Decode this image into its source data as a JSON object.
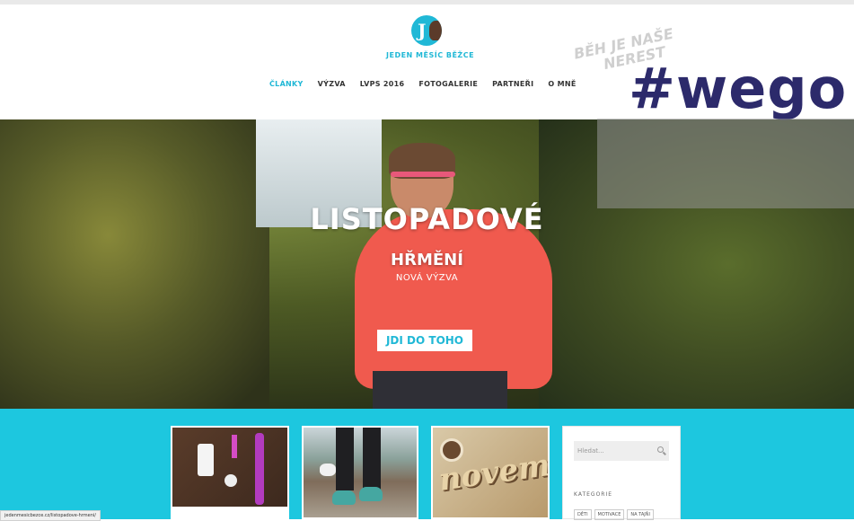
{
  "site": {
    "logo_text": "JEDEN MĚSÍC BĚŽCE",
    "logo_letter": "J"
  },
  "nav": {
    "items": [
      "ČLÁNKY",
      "VÝZVA",
      "LVPS 2016",
      "FOTOGALERIE",
      "PARTNEŘI",
      "O MNĚ"
    ],
    "active_index": 0
  },
  "watermark": {
    "line1": "BĚH JE NAŠE",
    "line2": "NEREST"
  },
  "overlay": {
    "hashtag": "#wego"
  },
  "hero": {
    "title_line1": "LISTOPADOVÉ",
    "title_line2": "HŘMĚNÍ",
    "subtitle": "NOVÁ VÝZVA",
    "cta_label": "JDI DO TOHO"
  },
  "cards": {
    "card3_word": "november"
  },
  "sidebar": {
    "search_placeholder": "Hledat...",
    "categories_title": "KATEGORIE",
    "tags": [
      "DĚTI",
      "MOTIVACE",
      "NA TAJŇI"
    ]
  },
  "status_bar": {
    "url": "jedenmesicbezce.cz/listopadove-hrmeni/"
  },
  "colors": {
    "accent": "#20b8d6",
    "teal_band": "#1dc7df",
    "cta_bg": "#ffffff",
    "overlay_text": "#2c2a6b"
  }
}
